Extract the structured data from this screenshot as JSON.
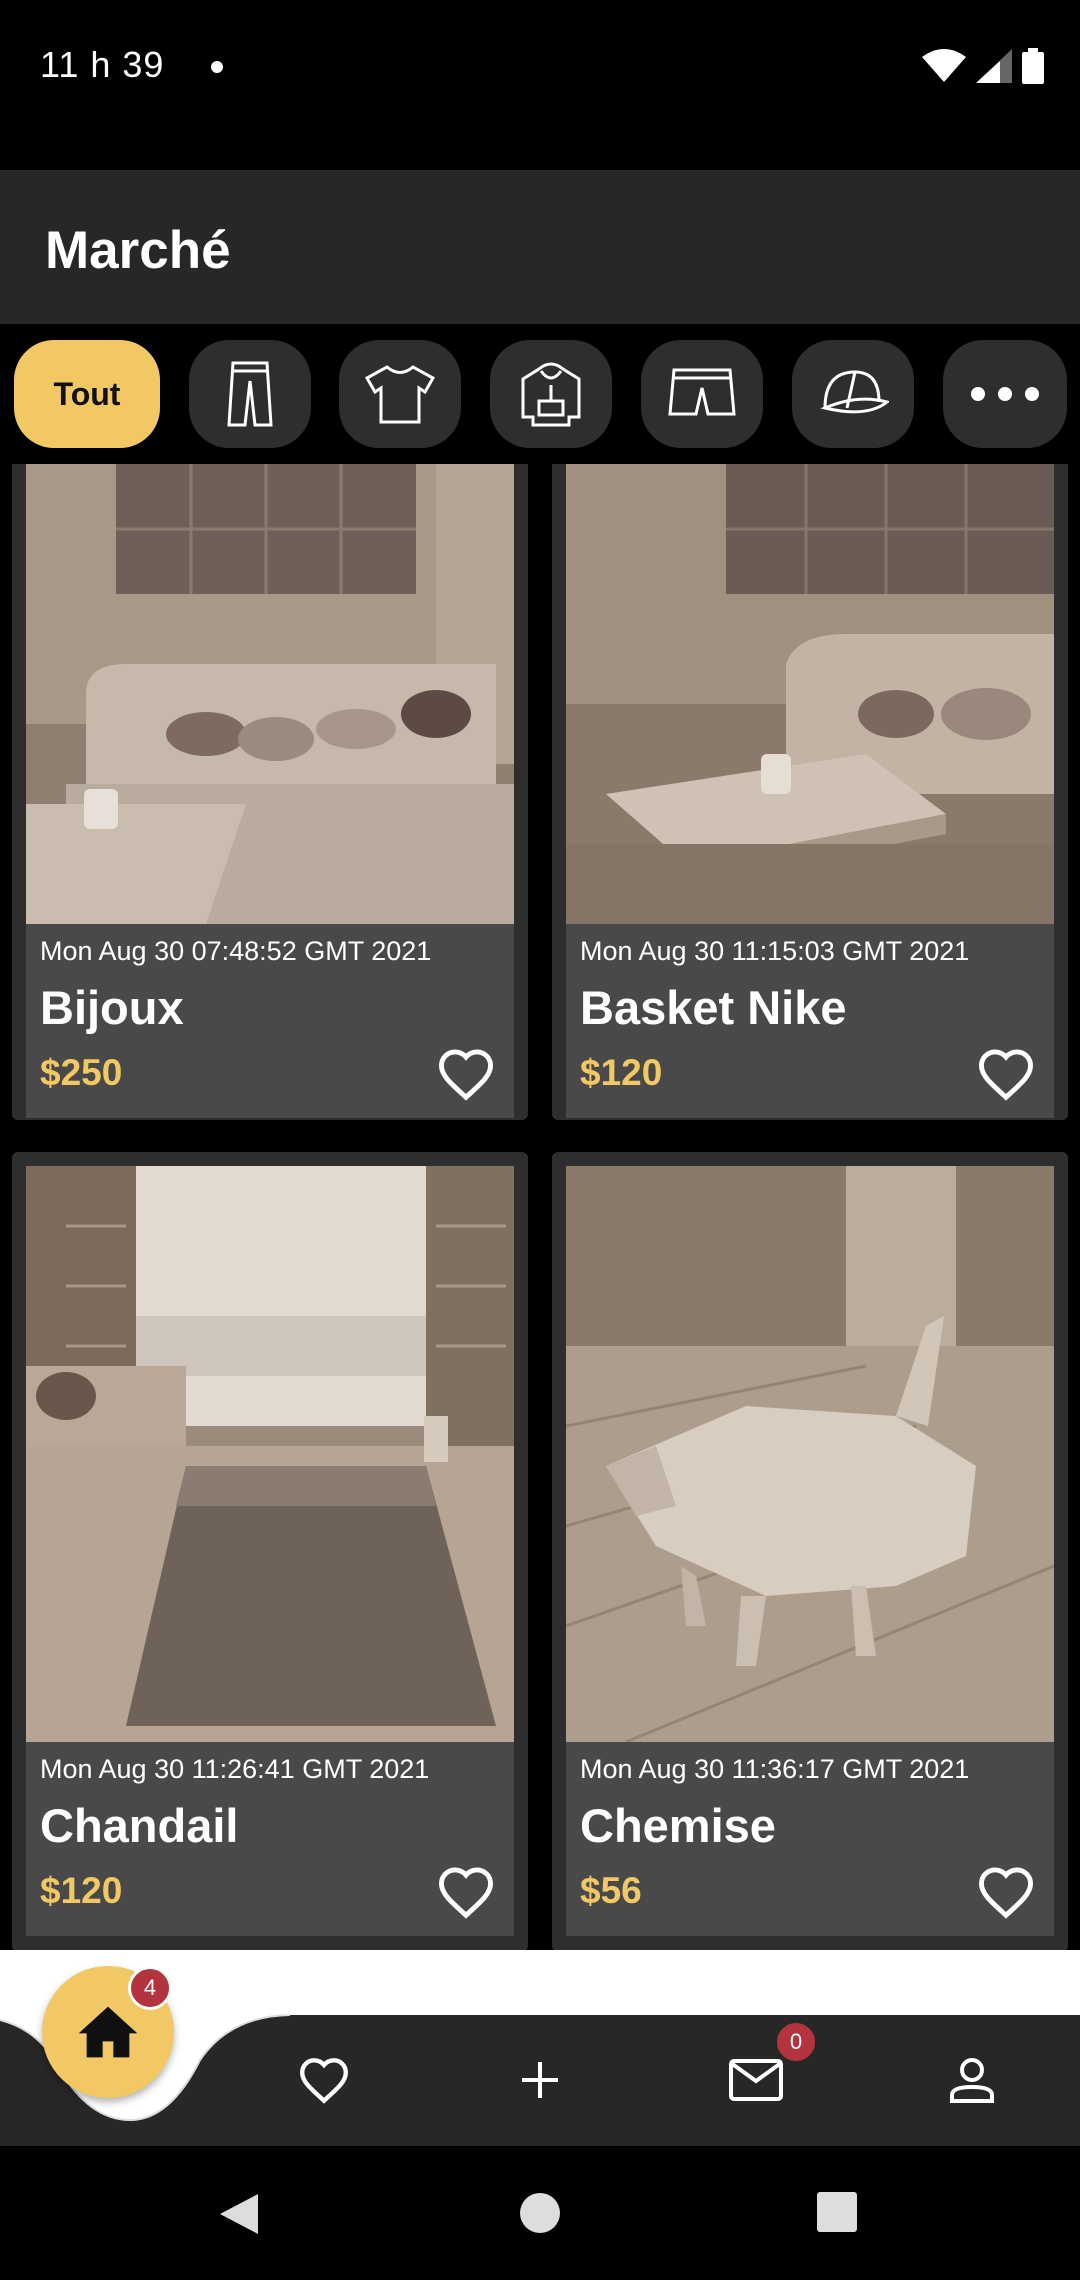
{
  "status_bar": {
    "time": "11 h 39"
  },
  "app_bar": {
    "title": "Marché"
  },
  "chips": [
    {
      "label": "Tout",
      "icon": "all",
      "active": true
    },
    {
      "label": "",
      "icon": "pants-icon",
      "active": false
    },
    {
      "label": "",
      "icon": "tshirt-icon",
      "active": false
    },
    {
      "label": "",
      "icon": "hoodie-icon",
      "active": false
    },
    {
      "label": "",
      "icon": "shorts-icon",
      "active": false
    },
    {
      "label": "",
      "icon": "cap-icon",
      "active": false
    },
    {
      "label": "",
      "icon": "more-icon",
      "active": false
    }
  ],
  "listings": [
    {
      "date": "Mon Aug 30 07:48:52 GMT 2021",
      "name": "Bijoux",
      "price": "$250",
      "image": "living-room-sofa"
    },
    {
      "date": "Mon Aug 30 11:15:03 GMT 2021",
      "name": "Basket Nike",
      "price": "$120",
      "image": "living-room-sofa-closeup"
    },
    {
      "date": "Mon Aug 30 11:26:41 GMT 2021",
      "name": "Chandail",
      "price": "$120",
      "image": "room-with-rug-and-window"
    },
    {
      "date": "Mon Aug 30 11:36:17 GMT 2021",
      "name": "Chemise",
      "price": "$56",
      "image": "low-poly-dog"
    }
  ],
  "bottom_nav": {
    "home_badge": "4",
    "messages_badge": "0"
  },
  "colors": {
    "accent": "#f2c865",
    "card_bg": "#2e2e2e",
    "info_bg": "#494949",
    "bar_bg": "#272727",
    "badge": "#b3343e"
  }
}
